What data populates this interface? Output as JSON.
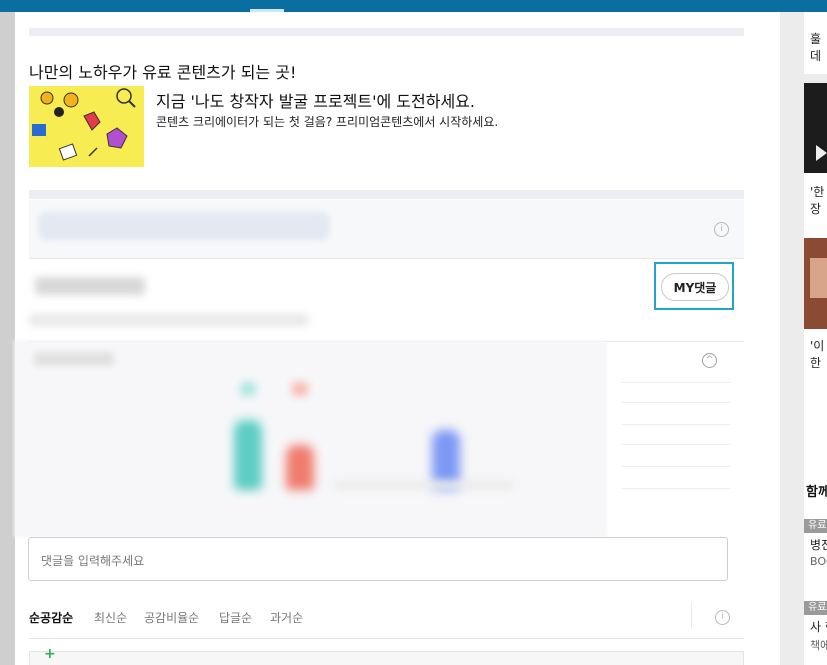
{
  "promo": {
    "title": "나만의 노하우가 유료 콘텐츠가 되는 곳!",
    "heading": "지금 '나도 창작자 발굴 프로젝트'에 도전하세요.",
    "subtext": "콘텐츠 크리에이터가 되는 첫 걸음? 프리미엄콘텐츠에서 시작하세요."
  },
  "comments": {
    "my_button": "MY댓글",
    "input_placeholder": "댓글을 입력해주세요",
    "sort_options": [
      "순공감순",
      "최신순",
      "공감비율순",
      "답글순",
      "과거순"
    ],
    "active_sort": "순공감순"
  },
  "sidebar": {
    "item1_line1": "훌",
    "item1_line2": "데",
    "item2_line1": "'한",
    "item2_line2": "장",
    "item3_line1": "'이",
    "item3_line2": "한",
    "section_heading": "함께",
    "badge1": "유료",
    "entry1_title": "병진",
    "entry1_sub": "BOC",
    "badge2": "유료",
    "entry2_title": "사 한",
    "entry2_sub": "책에"
  },
  "icons": {
    "info": "info-circle-icon",
    "chevron": "chevron-up-icon",
    "plus": "plus-icon",
    "play": "play-icon"
  },
  "colors": {
    "topbar": "#0b6ea0",
    "highlight": "#22a3d6",
    "promo_bg": "#f7ec52"
  }
}
